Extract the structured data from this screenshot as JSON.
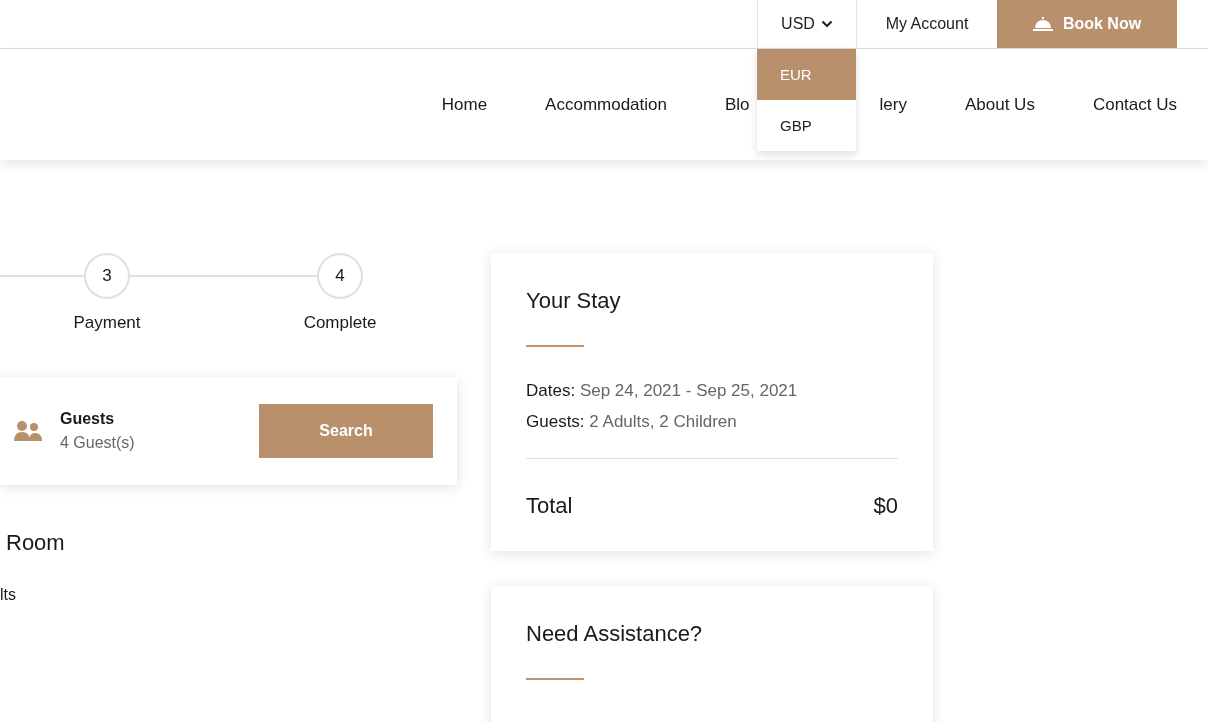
{
  "top_bar": {
    "currency": {
      "value": "USD",
      "expanded": true,
      "options": [
        {
          "label": "EUR",
          "selected": true
        },
        {
          "label": "GBP",
          "selected": false
        }
      ]
    },
    "account_link": "My Account",
    "book_button": "Book Now"
  },
  "nav": [
    {
      "label": "Home"
    },
    {
      "label": "Accommodation"
    },
    {
      "label": "Blo"
    },
    {
      "label": "lery"
    },
    {
      "label": "About Us"
    },
    {
      "label": "Contact Us"
    }
  ],
  "steps": [
    {
      "number": "3",
      "label": "Payment"
    },
    {
      "number": "4",
      "label": "Complete"
    }
  ],
  "search_bar": {
    "label": "Guests",
    "value": "4 Guest(s)",
    "button": "Search"
  },
  "room": {
    "title": "Room",
    "line": "lts"
  },
  "your_stay": {
    "title": "Your Stay",
    "rows": [
      {
        "label": "Dates:",
        "value": "Sep 24, 2021 - Sep 25, 2021"
      },
      {
        "label": "Guests:",
        "value": "2 Adults, 2 Children"
      }
    ],
    "total_label": "Total",
    "total_value": "$0"
  },
  "assistance": {
    "title": "Need Assistance?"
  }
}
